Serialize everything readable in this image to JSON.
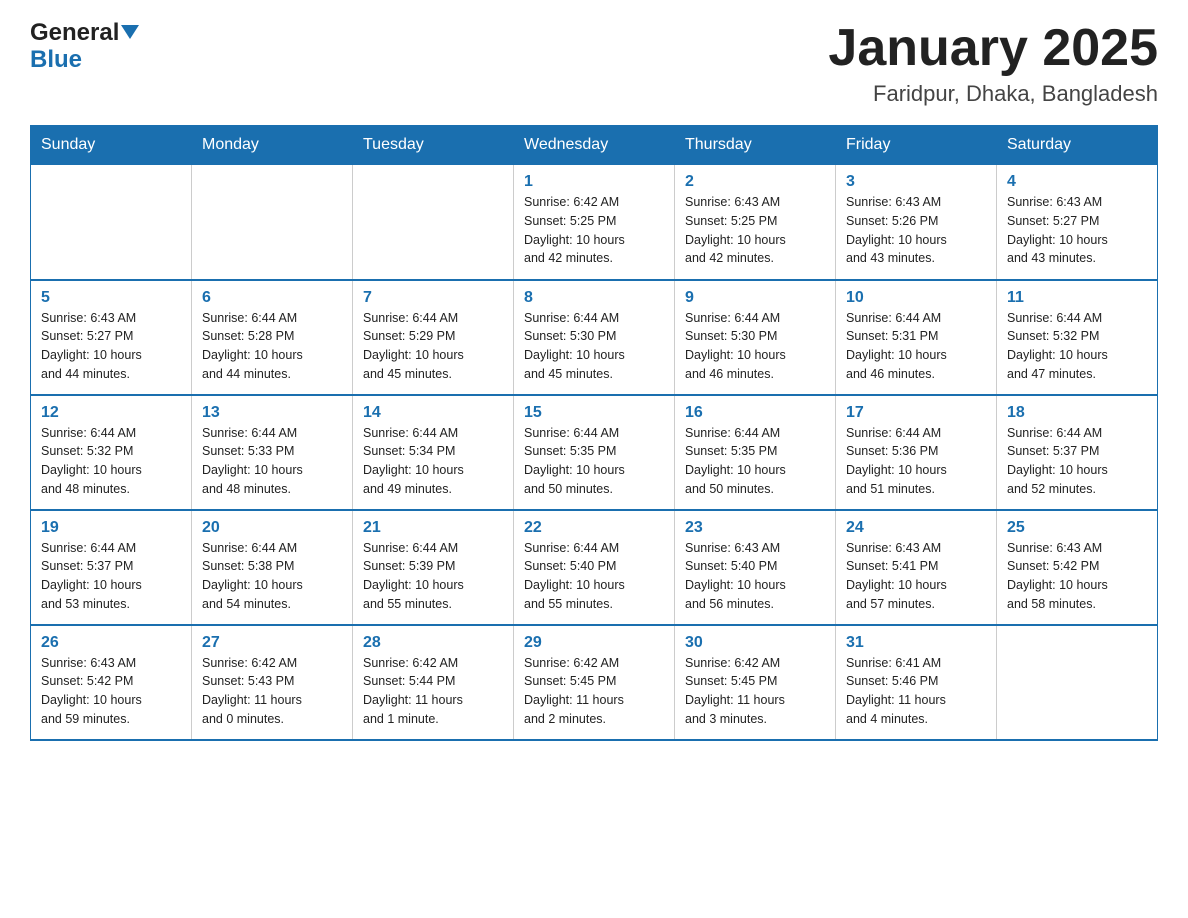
{
  "header": {
    "logo_text_general": "General",
    "logo_text_blue": "Blue",
    "title": "January 2025",
    "subtitle": "Faridpur, Dhaka, Bangladesh"
  },
  "weekdays": [
    "Sunday",
    "Monday",
    "Tuesday",
    "Wednesday",
    "Thursday",
    "Friday",
    "Saturday"
  ],
  "weeks": [
    [
      {
        "day": "",
        "info": ""
      },
      {
        "day": "",
        "info": ""
      },
      {
        "day": "",
        "info": ""
      },
      {
        "day": "1",
        "info": "Sunrise: 6:42 AM\nSunset: 5:25 PM\nDaylight: 10 hours\nand 42 minutes."
      },
      {
        "day": "2",
        "info": "Sunrise: 6:43 AM\nSunset: 5:25 PM\nDaylight: 10 hours\nand 42 minutes."
      },
      {
        "day": "3",
        "info": "Sunrise: 6:43 AM\nSunset: 5:26 PM\nDaylight: 10 hours\nand 43 minutes."
      },
      {
        "day": "4",
        "info": "Sunrise: 6:43 AM\nSunset: 5:27 PM\nDaylight: 10 hours\nand 43 minutes."
      }
    ],
    [
      {
        "day": "5",
        "info": "Sunrise: 6:43 AM\nSunset: 5:27 PM\nDaylight: 10 hours\nand 44 minutes."
      },
      {
        "day": "6",
        "info": "Sunrise: 6:44 AM\nSunset: 5:28 PM\nDaylight: 10 hours\nand 44 minutes."
      },
      {
        "day": "7",
        "info": "Sunrise: 6:44 AM\nSunset: 5:29 PM\nDaylight: 10 hours\nand 45 minutes."
      },
      {
        "day": "8",
        "info": "Sunrise: 6:44 AM\nSunset: 5:30 PM\nDaylight: 10 hours\nand 45 minutes."
      },
      {
        "day": "9",
        "info": "Sunrise: 6:44 AM\nSunset: 5:30 PM\nDaylight: 10 hours\nand 46 minutes."
      },
      {
        "day": "10",
        "info": "Sunrise: 6:44 AM\nSunset: 5:31 PM\nDaylight: 10 hours\nand 46 minutes."
      },
      {
        "day": "11",
        "info": "Sunrise: 6:44 AM\nSunset: 5:32 PM\nDaylight: 10 hours\nand 47 minutes."
      }
    ],
    [
      {
        "day": "12",
        "info": "Sunrise: 6:44 AM\nSunset: 5:32 PM\nDaylight: 10 hours\nand 48 minutes."
      },
      {
        "day": "13",
        "info": "Sunrise: 6:44 AM\nSunset: 5:33 PM\nDaylight: 10 hours\nand 48 minutes."
      },
      {
        "day": "14",
        "info": "Sunrise: 6:44 AM\nSunset: 5:34 PM\nDaylight: 10 hours\nand 49 minutes."
      },
      {
        "day": "15",
        "info": "Sunrise: 6:44 AM\nSunset: 5:35 PM\nDaylight: 10 hours\nand 50 minutes."
      },
      {
        "day": "16",
        "info": "Sunrise: 6:44 AM\nSunset: 5:35 PM\nDaylight: 10 hours\nand 50 minutes."
      },
      {
        "day": "17",
        "info": "Sunrise: 6:44 AM\nSunset: 5:36 PM\nDaylight: 10 hours\nand 51 minutes."
      },
      {
        "day": "18",
        "info": "Sunrise: 6:44 AM\nSunset: 5:37 PM\nDaylight: 10 hours\nand 52 minutes."
      }
    ],
    [
      {
        "day": "19",
        "info": "Sunrise: 6:44 AM\nSunset: 5:37 PM\nDaylight: 10 hours\nand 53 minutes."
      },
      {
        "day": "20",
        "info": "Sunrise: 6:44 AM\nSunset: 5:38 PM\nDaylight: 10 hours\nand 54 minutes."
      },
      {
        "day": "21",
        "info": "Sunrise: 6:44 AM\nSunset: 5:39 PM\nDaylight: 10 hours\nand 55 minutes."
      },
      {
        "day": "22",
        "info": "Sunrise: 6:44 AM\nSunset: 5:40 PM\nDaylight: 10 hours\nand 55 minutes."
      },
      {
        "day": "23",
        "info": "Sunrise: 6:43 AM\nSunset: 5:40 PM\nDaylight: 10 hours\nand 56 minutes."
      },
      {
        "day": "24",
        "info": "Sunrise: 6:43 AM\nSunset: 5:41 PM\nDaylight: 10 hours\nand 57 minutes."
      },
      {
        "day": "25",
        "info": "Sunrise: 6:43 AM\nSunset: 5:42 PM\nDaylight: 10 hours\nand 58 minutes."
      }
    ],
    [
      {
        "day": "26",
        "info": "Sunrise: 6:43 AM\nSunset: 5:42 PM\nDaylight: 10 hours\nand 59 minutes."
      },
      {
        "day": "27",
        "info": "Sunrise: 6:42 AM\nSunset: 5:43 PM\nDaylight: 11 hours\nand 0 minutes."
      },
      {
        "day": "28",
        "info": "Sunrise: 6:42 AM\nSunset: 5:44 PM\nDaylight: 11 hours\nand 1 minute."
      },
      {
        "day": "29",
        "info": "Sunrise: 6:42 AM\nSunset: 5:45 PM\nDaylight: 11 hours\nand 2 minutes."
      },
      {
        "day": "30",
        "info": "Sunrise: 6:42 AM\nSunset: 5:45 PM\nDaylight: 11 hours\nand 3 minutes."
      },
      {
        "day": "31",
        "info": "Sunrise: 6:41 AM\nSunset: 5:46 PM\nDaylight: 11 hours\nand 4 minutes."
      },
      {
        "day": "",
        "info": ""
      }
    ]
  ]
}
